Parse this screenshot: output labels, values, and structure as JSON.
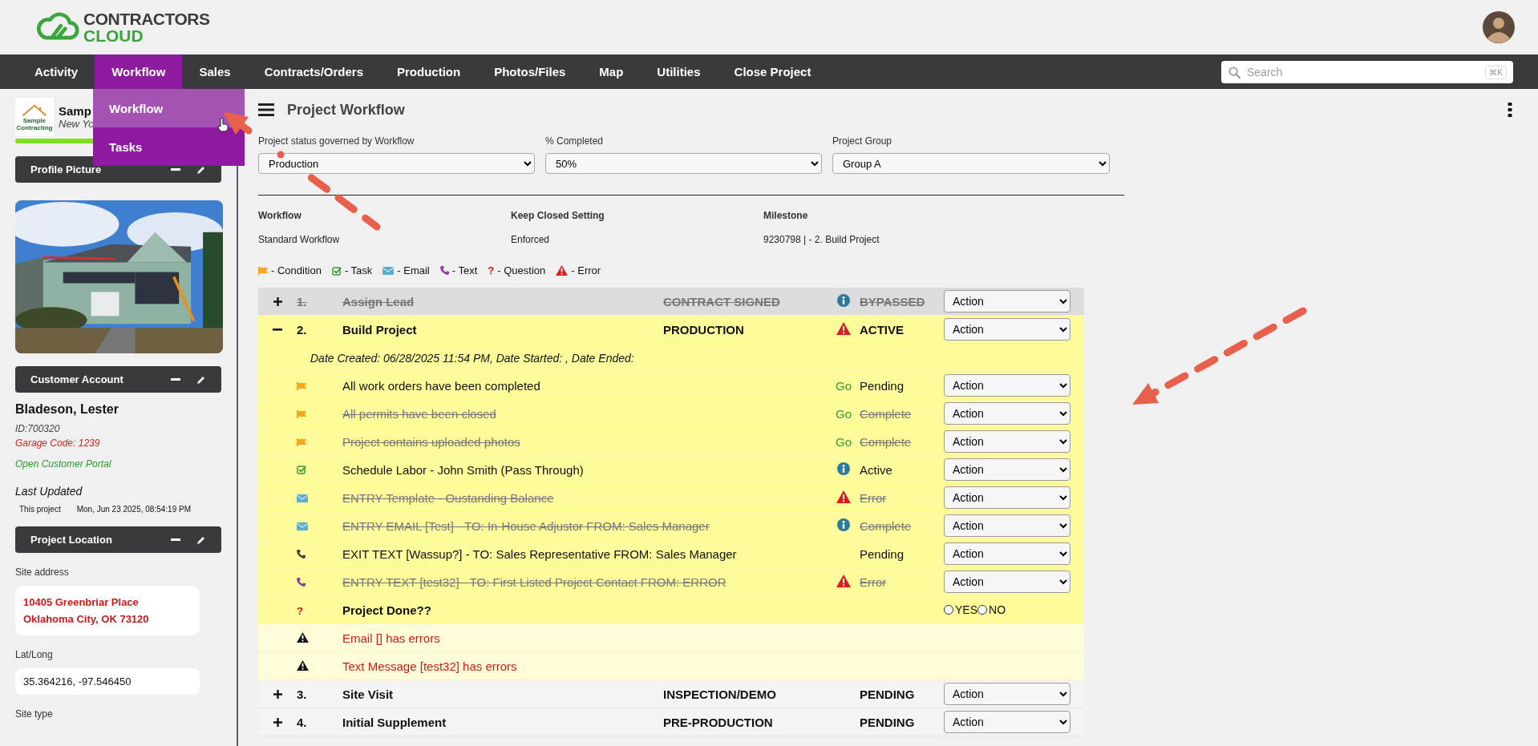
{
  "logo": {
    "line1": "CONTRACTORS",
    "line2": "CLOUD"
  },
  "nav": [
    {
      "label": "Activity",
      "selected": false
    },
    {
      "label": "Workflow",
      "selected": true
    },
    {
      "label": "Sales",
      "selected": false
    },
    {
      "label": "Contracts/Orders",
      "selected": false
    },
    {
      "label": "Production",
      "selected": false
    },
    {
      "label": "Photos/Files",
      "selected": false
    },
    {
      "label": "Map",
      "selected": false
    },
    {
      "label": "Utilities",
      "selected": false
    },
    {
      "label": "Close Project",
      "selected": false
    }
  ],
  "nav_menu": [
    {
      "label": "Workflow",
      "selected": true
    },
    {
      "label": "Tasks",
      "selected": false
    }
  ],
  "search": {
    "placeholder": "Search",
    "shortcut": "⌘K"
  },
  "company": {
    "logo_lines": [
      "Sample",
      "Contracting"
    ],
    "name": "Samp",
    "location": "New Yo"
  },
  "sidebar": {
    "profile_panel": "Profile Picture",
    "customer_panel": "Customer Account",
    "customer": {
      "name": "Bladeson, Lester",
      "id": "ID:700320",
      "garage_code": "Garage Code: 1239",
      "portal_link": "Open Customer Portal"
    },
    "last_updated": {
      "title": "Last Updated",
      "label": "This project",
      "value": "Mon, Jun 23 2025, 08:54:19 PM"
    },
    "location_panel": "Project Location",
    "site_address": {
      "label": "Site address",
      "lines": [
        "10405 Greenbriar Place",
        "Oklahoma City, OK 73120"
      ]
    },
    "lat_long": {
      "label": "Lat/Long",
      "value": "35.364216, -97.546450"
    },
    "site_type": {
      "label": "Site type"
    }
  },
  "page_title": "Project Workflow",
  "filters": [
    {
      "label": "Project status governed by Workflow",
      "value": "Production"
    },
    {
      "label": "% Completed",
      "value": "50%"
    },
    {
      "label": "Project Group",
      "value": "Group A"
    }
  ],
  "info": [
    {
      "label": "Workflow",
      "value": "Standard Workflow"
    },
    {
      "label": "Keep Closed Setting",
      "value": "Enforced"
    },
    {
      "label": "Milestone",
      "value": "9230798 | - 2. Build Project"
    }
  ],
  "legend": [
    {
      "kind": "condition",
      "label": "- Condition"
    },
    {
      "kind": "task",
      "label": "- Task"
    },
    {
      "kind": "email",
      "label": "- Email"
    },
    {
      "kind": "text",
      "label": "- Text"
    },
    {
      "kind": "question",
      "mark": "?",
      "label": "- Question"
    },
    {
      "kind": "error",
      "label": "- Error"
    }
  ],
  "stages": [
    {
      "number": "1.",
      "name": "Assign Lead",
      "phase": "CONTRACT SIGNED",
      "alert": {
        "kind": "info"
      },
      "status": "BYPASSED",
      "struck": true,
      "expanded": false,
      "action": "Action"
    },
    {
      "number": "2.",
      "name": "Build Project",
      "phase": "PRODUCTION",
      "alert": {
        "kind": "warning"
      },
      "status": "ACTIVE",
      "struck": false,
      "expanded": true,
      "action": "Action",
      "children": [
        {
          "kind": "dates",
          "text": "Date Created: 06/28/2025 11:54 PM, Date Started: , Date Ended:"
        },
        {
          "kind": "condition",
          "text": "All work orders have been completed",
          "go": "Go",
          "status": "Pending",
          "struck": false,
          "action": "Action"
        },
        {
          "kind": "condition",
          "text": "All permits have been closed",
          "go": "Go",
          "status": "Complete",
          "struck": true,
          "action": "Action"
        },
        {
          "kind": "condition",
          "text": "Project contains uploaded photos",
          "go": "Go",
          "status": "Complete",
          "struck": true,
          "action": "Action"
        },
        {
          "kind": "task",
          "text": "Schedule Labor - John Smith (Pass Through)",
          "alert": {
            "kind": "info"
          },
          "status": "Active",
          "struck": false,
          "action": "Action"
        },
        {
          "kind": "email",
          "text": "ENTRY Template - Oustanding Balance",
          "alert": {
            "kind": "warning"
          },
          "status": "Error",
          "struck": true,
          "action": "Action"
        },
        {
          "kind": "email",
          "text": "ENTRY EMAIL [Test] - TO: In-House Adjustor FROM: Sales Manager",
          "alert": {
            "kind": "info"
          },
          "status": "Complete",
          "struck": true,
          "action": "Action"
        },
        {
          "kind": "text",
          "color": "#444444",
          "text": "EXIT TEXT [Wassup?] - TO: Sales Representative FROM: Sales Manager",
          "status": "Pending",
          "struck": false,
          "action": "Action"
        },
        {
          "kind": "text",
          "color": "#8e3a9f",
          "text": "ENTRY TEXT [test32] - TO: First Listed Project Contact FROM: ERROR",
          "alert": {
            "kind": "warning"
          },
          "status": "Error",
          "struck": true,
          "action": "Action"
        },
        {
          "kind": "question",
          "mark": "?",
          "text": "Project Done??",
          "options": [
            {
              "label": "YES",
              "selected": false
            },
            {
              "label": "NO",
              "selected": false
            }
          ]
        },
        {
          "kind": "error",
          "text": "Email [] has errors"
        },
        {
          "kind": "error",
          "text": "Text Message [test32] has errors"
        }
      ]
    },
    {
      "number": "3.",
      "name": "Site Visit",
      "phase": "INSPECTION/DEMO",
      "status": "PENDING",
      "struck": false,
      "expanded": false,
      "action": "Action"
    },
    {
      "number": "4.",
      "name": "Initial Supplement",
      "phase": "PRE-PRODUCTION",
      "status": "PENDING",
      "struck": false,
      "expanded": false,
      "action": "Action"
    }
  ]
}
